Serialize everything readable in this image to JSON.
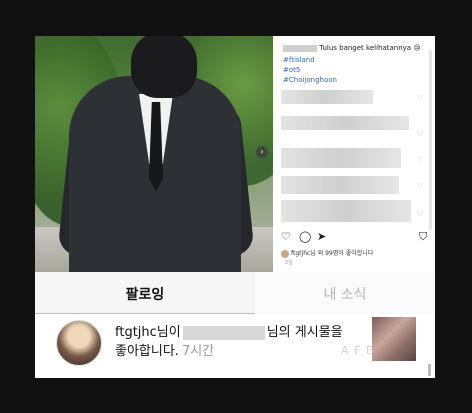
{
  "post": {
    "caption": "Tulus banget kelihatannya 😢",
    "hashtags": [
      "#ftisland",
      "#ot5",
      "#Choijonghoon"
    ],
    "likes_text": "ftgtjhc님 외 99명이 좋아합니다",
    "time": "2일",
    "next_icon": "chevron-right-icon"
  },
  "tabs": {
    "following": "팔로잉",
    "my_news": "내 소식"
  },
  "notification": {
    "username": "ftgtjhc",
    "text_after_user": "님이",
    "text_after_redact": "님의 게시물을",
    "line2": "좋아합니다.",
    "time": "7시간"
  },
  "watermark": "A F E X",
  "colors": {
    "hashtag": "#2f68b7",
    "background": "#111111"
  }
}
